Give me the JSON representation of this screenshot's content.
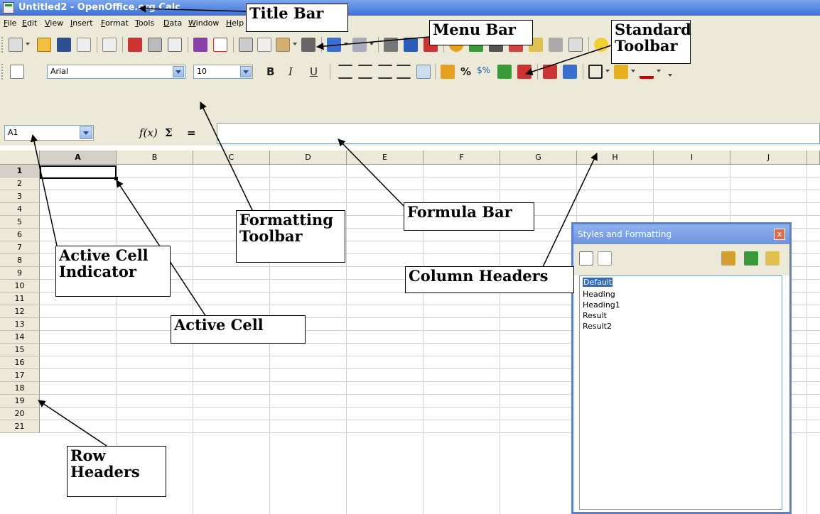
{
  "window": {
    "title": "Untitled2 - OpenOffice.org Calc"
  },
  "menu": [
    "File",
    "Edit",
    "View",
    "Insert",
    "Format",
    "Tools",
    "Data",
    "Window",
    "Help"
  ],
  "formatting": {
    "font_name": "Arial",
    "font_size": "10",
    "bold": "B",
    "italic": "I",
    "underline": "U",
    "percent": "%",
    "currency": "$%"
  },
  "formula_bar": {
    "cell_ref": "A1",
    "function_wizard": "f(x)",
    "sum": "Σ",
    "equals": "="
  },
  "columns": [
    "A",
    "B",
    "C",
    "D",
    "E",
    "F",
    "G",
    "H",
    "I",
    "J"
  ],
  "rows": [
    "1",
    "2",
    "3",
    "4",
    "5",
    "6",
    "7",
    "8",
    "9",
    "10",
    "11",
    "12",
    "13",
    "14",
    "15",
    "16",
    "17",
    "18",
    "19",
    "20",
    "21"
  ],
  "styles_panel": {
    "title": "Styles and Formatting",
    "close": "x",
    "items": [
      "Default",
      "Heading",
      "Heading1",
      "Result",
      "Result2"
    ]
  },
  "callouts": {
    "title_bar": "Title Bar",
    "menu_bar": "Menu Bar",
    "standard_toolbar": "Standard Toolbar",
    "formatting_toolbar": "Formatting Toolbar",
    "formula_bar": "Formula Bar",
    "column_headers": "Column Headers",
    "active_cell_indicator": "Active Cell Indicator",
    "active_cell": "Active Cell",
    "row_headers": "Row Headers"
  }
}
